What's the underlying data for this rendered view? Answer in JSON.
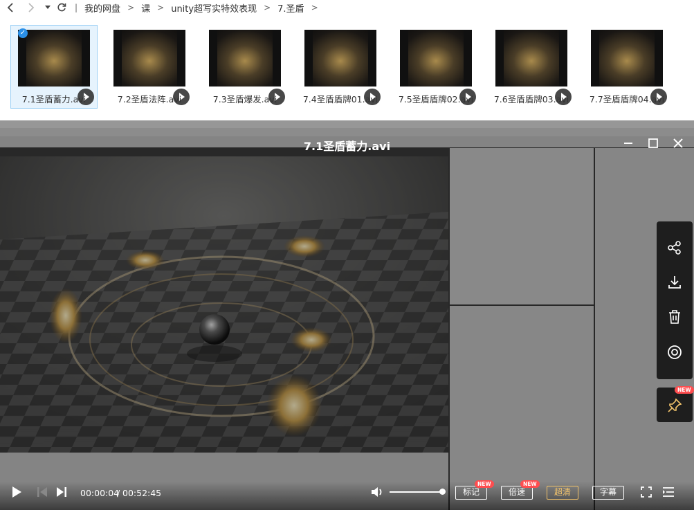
{
  "breadcrumb": {
    "items": [
      "我的网盘",
      "课",
      "unity超写实特效表现",
      "7.圣盾"
    ]
  },
  "thumbnails": [
    {
      "label": "7.1圣盾蓄力.avi",
      "selected": true
    },
    {
      "label": "7.2圣盾法阵.avi",
      "selected": false
    },
    {
      "label": "7.3圣盾爆发.avi",
      "selected": false
    },
    {
      "label": "7.4圣盾盾牌01.avi",
      "selected": false
    },
    {
      "label": "7.5圣盾盾牌02.avi",
      "selected": false
    },
    {
      "label": "7.6圣盾盾牌03.avi",
      "selected": false
    },
    {
      "label": "7.7圣盾盾牌04.avi",
      "selected": false
    }
  ],
  "player": {
    "title": "7.1圣盾蓄力.avi",
    "current_time": "00:00:04",
    "separator": "/",
    "total_time": "00:52:45",
    "progress_fraction": 0.0013,
    "volume_fraction": 1.0,
    "buttons": {
      "mark": "标记",
      "speed": "倍速",
      "quality": "超清",
      "subtitle": "字幕"
    },
    "new_badge": "NEW"
  },
  "colors": {
    "selected_bg": "#e6f3fd",
    "selected_border": "#9cd0f5",
    "quality_accent": "#f2c36b",
    "badge_red": "#ff4d4f"
  }
}
